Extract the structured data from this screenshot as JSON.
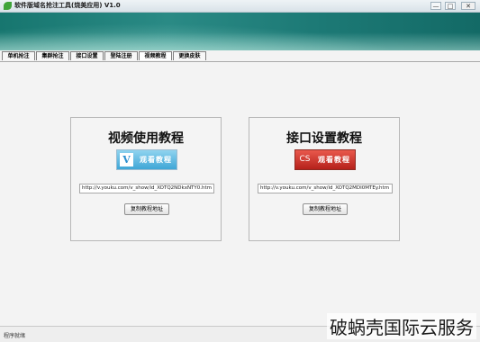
{
  "window": {
    "title": "软件版域名抢注工具(烧美应用) V1.0",
    "minimize": "—",
    "maximize": "□",
    "close": "✕"
  },
  "tabs": [
    {
      "label": "单机抢注"
    },
    {
      "label": "集群抢注"
    },
    {
      "label": "接口设置"
    },
    {
      "label": "登陆注册"
    },
    {
      "label": "视频教程"
    },
    {
      "label": "更换皮肤"
    }
  ],
  "active_tab": "视频教程",
  "panels": {
    "left": {
      "title": "视频使用教程",
      "logo": "V",
      "video_button": "观看教程",
      "url": "http://v.youku.com/v_show/id_XOTQ2NDkxNTY0.htm",
      "copy_button": "复制教程地址"
    },
    "right": {
      "title": "接口设置教程",
      "logo": "CS",
      "video_button": "观看教程",
      "url": "http://v.youku.com/v_show/id_XOTQ2MDI0MTEy.htm",
      "copy_button": "复制教程地址"
    }
  },
  "status": {
    "text": "程序就绪"
  },
  "watermark": "破蜗壳国际云服务",
  "colors": {
    "banner": "#1d7a76",
    "video_button_blue": "#3fa6d6",
    "video_button_red": "#b5211b"
  }
}
